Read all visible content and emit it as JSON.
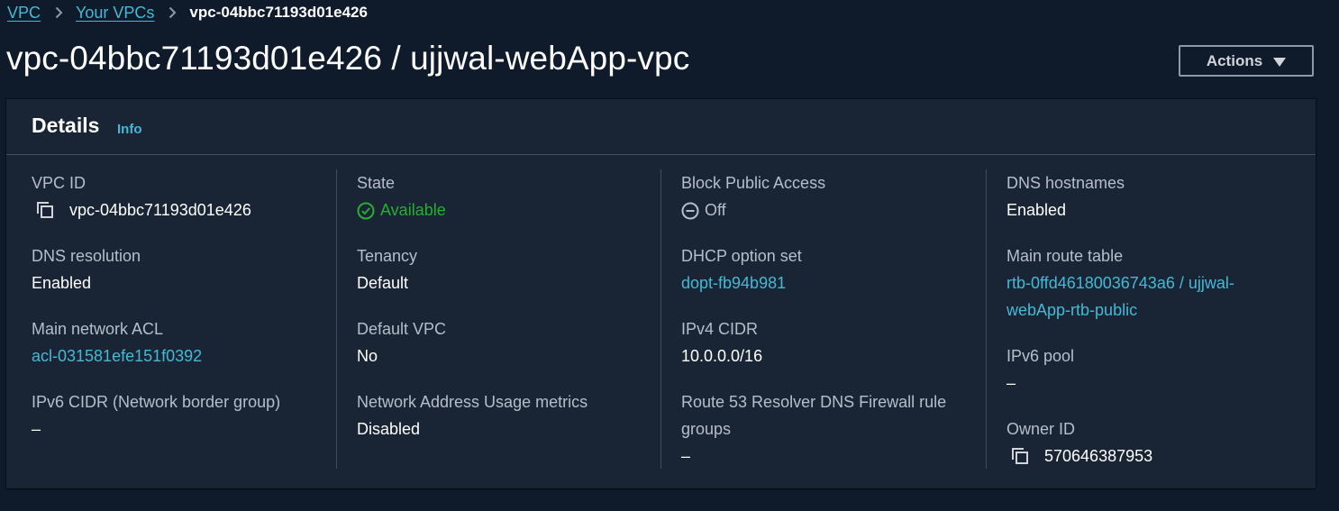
{
  "breadcrumb": {
    "items": [
      "VPC",
      "Your VPCs"
    ],
    "current": "vpc-04bbc71193d01e426"
  },
  "page": {
    "title": "vpc-04bbc71193d01e426 / ujjwal-webApp-vpc",
    "actions_label": "Actions"
  },
  "details": {
    "title": "Details",
    "info_label": "Info",
    "vpc_id": {
      "label": "VPC ID",
      "value": "vpc-04bbc71193d01e426",
      "icon": "copy-icon"
    },
    "dns_resolution": {
      "label": "DNS resolution",
      "value": "Enabled"
    },
    "main_network_acl": {
      "label": "Main network ACL",
      "value": "acl-031581efe151f0392"
    },
    "ipv6_cidr": {
      "label": "IPv6 CIDR (Network border group)",
      "value": "–"
    },
    "state": {
      "label": "State",
      "value": "Available",
      "icon": "check-circle-icon",
      "color": "#29ad32"
    },
    "tenancy": {
      "label": "Tenancy",
      "value": "Default"
    },
    "default_vpc": {
      "label": "Default VPC",
      "value": "No"
    },
    "nau_metrics": {
      "label": "Network Address Usage metrics",
      "value": "Disabled"
    },
    "block_public_access": {
      "label": "Block Public Access",
      "value": "Off",
      "icon": "minus-circle-icon"
    },
    "dhcp_option_set": {
      "label": "DHCP option set",
      "value": "dopt-fb94b981"
    },
    "ipv4_cidr": {
      "label": "IPv4 CIDR",
      "value": "10.0.0.0/16"
    },
    "route53_firewall": {
      "label_line1": "Route 53 Resolver DNS Firewall rule",
      "label_line2": "groups",
      "value": "–"
    },
    "dns_hostnames": {
      "label": "DNS hostnames",
      "value": "Enabled"
    },
    "main_route_table": {
      "label": "Main route table",
      "value_line1": "rtb-0ffd46180036743a6 / ujjwal-",
      "value_line2": "webApp-rtb-public"
    },
    "ipv6_pool": {
      "label": "IPv6 pool",
      "value": "–"
    },
    "owner_id": {
      "label": "Owner ID",
      "value": "570646387953",
      "icon": "copy-icon"
    }
  },
  "colors": {
    "background": "#0f1b2a",
    "panel": "#192534",
    "link": "#44b9d6",
    "success": "#29ad32"
  }
}
